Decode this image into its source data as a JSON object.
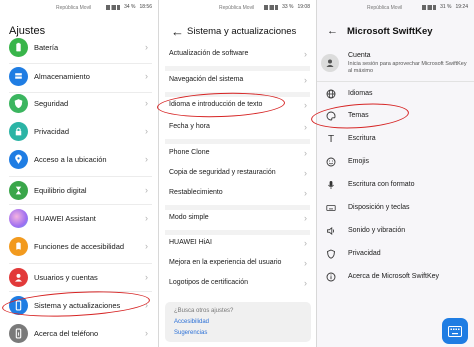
{
  "panel1": {
    "status": {
      "carrier": "República Movil",
      "battery": "34 %",
      "time": "18:56"
    },
    "title": "Ajustes",
    "items": [
      {
        "label": "Batería",
        "icon": "battery-icon",
        "color": "#39b54a"
      },
      {
        "label": "Almacenamiento",
        "icon": "storage-icon",
        "color": "#1f7de3"
      },
      {
        "label": "Seguridad",
        "icon": "security-shield-icon",
        "color": "#3bb55f"
      },
      {
        "label": "Privacidad",
        "icon": "privacy-icon",
        "color": "#2bb4a5"
      },
      {
        "label": "Acceso a la ubicación",
        "icon": "location-icon",
        "color": "#1f7de3"
      },
      {
        "label": "Equilibrio digital",
        "icon": "hourglass-icon",
        "color": "#3aa64a"
      },
      {
        "label": "HUAWEI Assistant",
        "icon": "assistant-icon",
        "color": "#a06ff0"
      },
      {
        "label": "Funciones de accesibilidad",
        "icon": "accessibility-icon",
        "color": "#f29a1e"
      },
      {
        "label": "Usuarios y cuentas",
        "icon": "user-icon",
        "color": "#e23a3a"
      },
      {
        "label": "Sistema y actualizaciones",
        "icon": "phone-system-icon",
        "color": "#1f7de3"
      },
      {
        "label": "Acerca del teléfono",
        "icon": "info-phone-icon",
        "color": "#7a7a7a"
      }
    ]
  },
  "panel2": {
    "status": {
      "carrier": "República Movil",
      "battery": "33 %",
      "time": "19:08"
    },
    "title": "Sistema y actualizaciones",
    "items": [
      "Actualización de software",
      "Navegación del sistema",
      "Idioma e introducción de texto",
      "Fecha y hora",
      "Phone Clone",
      "Copia de seguridad y restauración",
      "Restablecimiento",
      "Modo simple",
      "HUAWEI HiAI",
      "Mejora en la experiencia del usuario",
      "Logotipos de certificación"
    ],
    "help": {
      "question": "¿Busca otros ajustes?",
      "link1": "Accesibilidad",
      "link2": "Sugerencias"
    }
  },
  "panel3": {
    "status": {
      "carrier": "República Movil",
      "battery": "31 %",
      "time": "19:24"
    },
    "title": "Microsoft SwiftKey",
    "account": {
      "label": "Cuenta",
      "sub": "Inicia sesión para aprovechar Microsoft SwiftKey al máximo"
    },
    "items": [
      {
        "label": "Idiomas",
        "icon": "globe-icon"
      },
      {
        "label": "Temas",
        "icon": "palette-icon"
      },
      {
        "label": "Escritura",
        "icon": "text-t-icon"
      },
      {
        "label": "Emojis",
        "icon": "emoji-icon"
      },
      {
        "label": "Escritura con formato",
        "icon": "microphone-icon"
      },
      {
        "label": "Disposición y teclas",
        "icon": "keyboard-icon"
      },
      {
        "label": "Sonido y vibración",
        "icon": "speaker-icon"
      },
      {
        "label": "Privacidad",
        "icon": "shield-icon"
      },
      {
        "label": "Acerca de Microsoft SwiftKey",
        "icon": "info-icon"
      }
    ]
  },
  "colors": {
    "highlight": "#d62424",
    "link": "#2a6fd6",
    "accent": "#1f7de3"
  }
}
